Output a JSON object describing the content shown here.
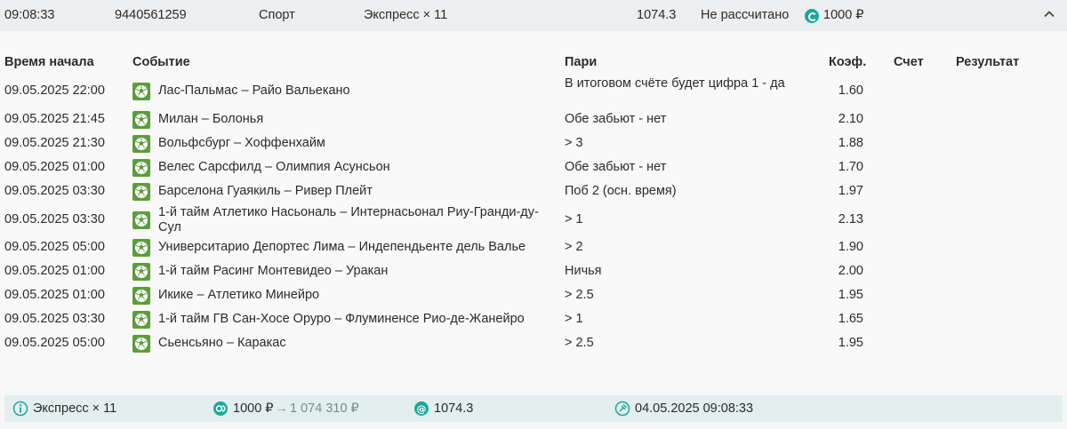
{
  "bet": {
    "time": "09:08:33",
    "id": "9440561259",
    "sport": "Спорт",
    "type": "Экспресс × 11",
    "coef": "1074.3",
    "status": "Не рассчитано",
    "stake": "1000 ₽"
  },
  "table": {
    "headers": [
      "Время начала",
      "Событие",
      "Пари",
      "Коэф.",
      "Счет",
      "Результат"
    ],
    "rows": [
      {
        "time": "09.05.2025 22:00",
        "event": "Лас-Пальмас – Райо Вальекано",
        "bet": "В итоговом счёте будет цифра 1 - да",
        "coef": "1.60",
        "score": "",
        "result": ""
      },
      {
        "time": "09.05.2025 21:45",
        "event": "Милан – Болонья",
        "bet": "Обе забьют - нет",
        "coef": "2.10",
        "score": "",
        "result": ""
      },
      {
        "time": "09.05.2025 21:30",
        "event": "Вольфсбург – Хоффенхайм",
        "bet": "> 3",
        "coef": "1.88",
        "score": "",
        "result": ""
      },
      {
        "time": "09.05.2025 01:00",
        "event": "Велес Сарсфилд – Олимпия Асунсьон",
        "bet": "Обе забьют - нет",
        "coef": "1.70",
        "score": "",
        "result": ""
      },
      {
        "time": "09.05.2025 03:30",
        "event": "Барселона Гуаякиль – Ривер Плейт",
        "bet": "Поб 2 (осн. время)",
        "coef": "1.97",
        "score": "",
        "result": ""
      },
      {
        "time": "09.05.2025 03:30",
        "event": "1-й тайм Атлетико Насьональ – Интернасьонал Риу-Гранди-ду-Сул",
        "bet": "> 1",
        "coef": "2.13",
        "score": "",
        "result": ""
      },
      {
        "time": "09.05.2025 05:00",
        "event": "Университарио Депортес Лима – Индепендьенте дель Валье",
        "bet": "> 2",
        "coef": "1.90",
        "score": "",
        "result": ""
      },
      {
        "time": "09.05.2025 01:00",
        "event": "1-й тайм Расинг Монтевидео – Уракан",
        "bet": "Ничья",
        "coef": "2.00",
        "score": "",
        "result": ""
      },
      {
        "time": "09.05.2025 01:00",
        "event": "Икике – Атлетико Минейро",
        "bet": "> 2.5",
        "coef": "1.95",
        "score": "",
        "result": ""
      },
      {
        "time": "09.05.2025 03:30",
        "event": "1-й тайм ГВ Сан-Хосе Оруро – Флуминенсе Рио-де-Жанейро",
        "bet": "> 1",
        "coef": "1.65",
        "score": "",
        "result": ""
      },
      {
        "time": "09.05.2025 05:00",
        "event": "Сьенсьяно – Каракас",
        "bet": "> 2.5",
        "coef": "1.95",
        "score": "",
        "result": ""
      }
    ]
  },
  "footer": {
    "type": "Экспресс × 11",
    "stake": "1000 ₽",
    "potential_win": "1 074 310 ₽",
    "coef": "1074.3",
    "date": "04.05.2025 09:08:33"
  },
  "icons": {
    "sport": "soccer-ball-icon",
    "stake": "coin-icon",
    "toggle": "chevron-up-icon",
    "info": "info-icon",
    "coef": "at-icon",
    "date": "pin-icon"
  },
  "colors": {
    "accent": "#1aa89b",
    "sport_icon": "#5a9e3a",
    "footer_bg": "#e2efee"
  }
}
